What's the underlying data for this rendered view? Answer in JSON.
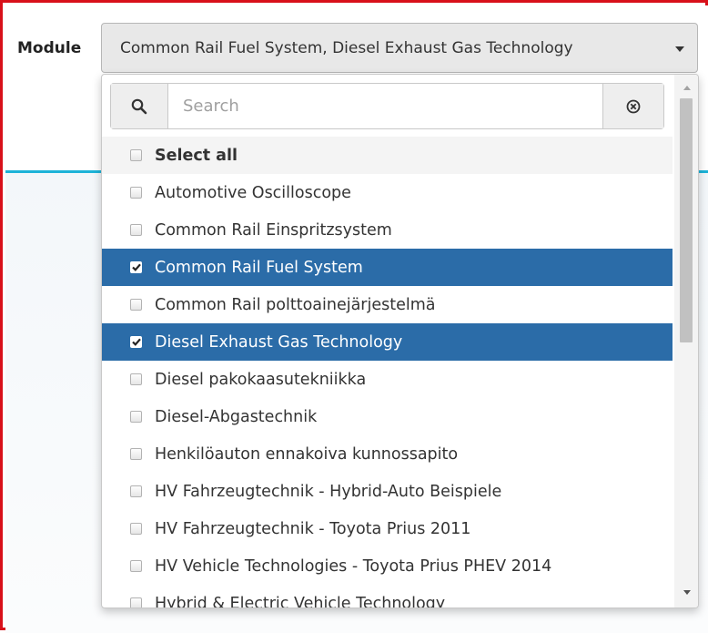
{
  "module": {
    "label": "Module",
    "selected_text": "Common Rail Fuel System, Diesel Exhaust Gas Technology"
  },
  "search": {
    "placeholder": "Search",
    "search_icon": "search-icon",
    "clear_icon": "clear-circle-icon"
  },
  "options": [
    {
      "label": "Select all",
      "checked": false
    },
    {
      "label": "Automotive Oscilloscope",
      "checked": false
    },
    {
      "label": "Common Rail Einspritzsystem",
      "checked": false
    },
    {
      "label": "Common Rail Fuel System",
      "checked": true
    },
    {
      "label": "Common Rail polttoainejärjestelmä",
      "checked": false
    },
    {
      "label": "Diesel Exhaust Gas Technology",
      "checked": true
    },
    {
      "label": "Diesel pakokaasutekniikka",
      "checked": false
    },
    {
      "label": "Diesel-Abgastechnik",
      "checked": false
    },
    {
      "label": "Henkilöauton ennakoiva kunnossapito",
      "checked": false
    },
    {
      "label": "HV Fahrzeugtechnik - Hybrid-Auto Beispiele",
      "checked": false
    },
    {
      "label": "HV Fahrzeugtechnik - Toyota Prius 2011",
      "checked": false
    },
    {
      "label": "HV Vehicle Technologies - Toyota Prius PHEV 2014",
      "checked": false
    },
    {
      "label": "Hybrid & Electric Vehicle Technology",
      "checked": false
    }
  ],
  "colors": {
    "selected_bg": "#2b6ca8",
    "frame_border": "#d8101a",
    "accent_line": "#1db3d8"
  }
}
